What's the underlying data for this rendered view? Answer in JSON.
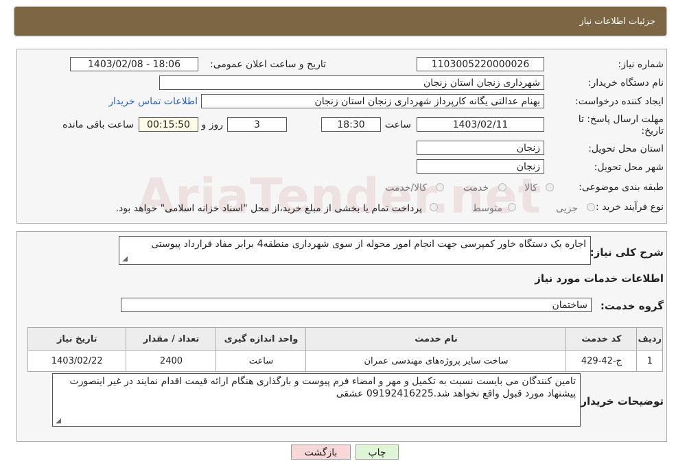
{
  "header": {
    "title": "جزئیات اطلاعات نیاز"
  },
  "form": {
    "need_number_label": "شماره نیاز:",
    "need_number": "1103005220000026",
    "announce_label": "تاریخ و ساعت اعلان عمومی:",
    "announce_value": "1403/02/08 - 18:06",
    "buyer_org_label": "نام دستگاه خریدار:",
    "buyer_org": "شهرداری زنجان استان زنجان",
    "creator_label": "ایجاد کننده درخواست:",
    "creator": "بهنام عدالتی یگانه کارپرداز شهرداری زنجان استان زنجان",
    "contact_link": "اطلاعات تماس خریدار",
    "deadline_label_1": "مهلت ارسال پاسخ: تا",
    "deadline_label_2": "تاریخ:",
    "deadline_date": "1403/02/11",
    "time_label": "ساعت",
    "deadline_time": "18:30",
    "days_value": "3",
    "days_label": "روز و",
    "remaining_time": "00:15:50",
    "remaining_label": "ساعت باقی مانده",
    "province_label": "استان محل تحویل:",
    "province": "زنجان",
    "city_label": "شهر محل تحویل:",
    "city": "زنجان",
    "category_label": "طبقه بندی موضوعی:",
    "category_options": [
      "کالا",
      "خدمت",
      "کالا/خدمت"
    ],
    "purchase_type_label": "نوع فرآیند خرید :",
    "purchase_options": [
      "جزیی",
      "متوسط"
    ],
    "purchase_note_checkbox": "پرداخت تمام یا بخشی از مبلغ خرید،از محل \"اسناد خزانه اسلامی\" خواهد بود."
  },
  "details": {
    "general_desc_label": "شرح کلی نیاز:",
    "general_desc": "اجاره یک دستگاه خاور کمپرسی جهت انجام امور محوله از سوی شهرداری منطقه4 برابر مفاد قرارداد پیوستی",
    "services_title": "اطلاعات خدمات مورد نیاز",
    "service_group_label": "گروه خدمت:",
    "service_group": "ساختمان",
    "table_headers": [
      "ردیف",
      "کد خدمت",
      "نام خدمت",
      "واحد اندازه گیری",
      "تعداد / مقدار",
      "تاریخ نیاز"
    ],
    "table_rows": [
      {
        "row": "1",
        "code": "ج-42-429",
        "name": "ساخت سایر پروژه‌های مهندسی عمران",
        "unit": "ساعت",
        "qty": "2400",
        "date": "1403/02/22"
      }
    ],
    "buyer_notes_label": "توضیحات خریدار:",
    "buyer_notes": "تامین کنندگان می بایست نسبت به تکمیل و مهر و امضاء فرم پیوست و بارگذاری هنگام ارائه قیمت اقدام نمایند در غیر اینصورت پیشنهاد مورد قبول واقع نخواهد شد.09192416225 عشقی"
  },
  "buttons": {
    "print": "چاپ",
    "back": "بازگشت"
  },
  "watermark": "AriaTender.net",
  "colors": {
    "header_bg": "#7d6644",
    "link": "#2a61b8",
    "print_btn": "#dff5d5",
    "back_btn": "#f7d7d7"
  }
}
